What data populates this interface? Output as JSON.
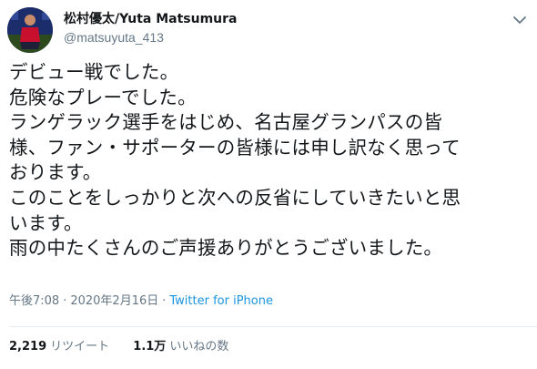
{
  "author": {
    "display_name": "松村優太/Yuta Matsumura",
    "handle": "@matsuyuta_413"
  },
  "tweet": {
    "lines": [
      "デビュー戦でした。",
      "危険なプレーでした。",
      "ランゲラック選手をはじめ、名古屋グランパスの皆",
      "様、ファン・サポーターの皆様には申し訳なく思って",
      "おります。",
      "このことをしっかりと次への反省にしていきたいと思",
      "います。",
      "雨の中たくさんのご声援ありがとうございました。"
    ]
  },
  "meta": {
    "time": "午後7:08",
    "separator": "·",
    "date": "2020年2月16日",
    "source": "Twitter for iPhone"
  },
  "stats": {
    "retweets_count": "2,219",
    "retweets_label": "リツイート",
    "likes_count": "1.1万",
    "likes_label": "いいねの数"
  },
  "colors": {
    "text": "#14171a",
    "secondary": "#657786",
    "link": "#1b95e0",
    "divider": "#e6ecf0"
  },
  "icons": {
    "menu": "chevron-down-icon",
    "avatar": "profile-photo"
  }
}
